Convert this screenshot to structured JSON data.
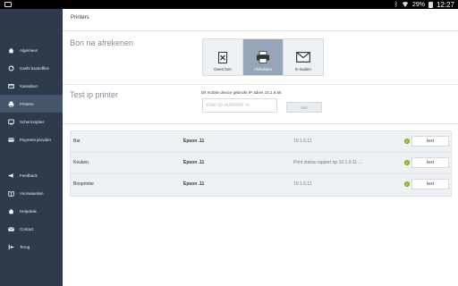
{
  "statusbar": {
    "battery": "29%",
    "time": "12:27"
  },
  "sidebar": {
    "items": [
      {
        "label": "Algemeen",
        "icon": "home-icon"
      },
      {
        "label": "Cashi backoffice",
        "icon": "refresh-icon"
      },
      {
        "label": "Kassabon",
        "icon": "receipt-icon"
      },
      {
        "label": "Printers",
        "icon": "printer-icon",
        "active": true
      },
      {
        "label": "Schermopties",
        "icon": "screen-icon"
      },
      {
        "label": "Payment provider",
        "icon": "card-icon"
      },
      {
        "label": "Feedback",
        "icon": "megaphone-icon"
      },
      {
        "label": "Voorwaarden",
        "icon": "book-icon"
      },
      {
        "label": "Helpdesk",
        "icon": "help-home-icon"
      },
      {
        "label": "Contact",
        "icon": "mail-icon"
      },
      {
        "label": "Terug",
        "icon": "back-icon"
      }
    ]
  },
  "page": {
    "title": "Printers"
  },
  "receipt_section": {
    "label": "Bon na afrekenen",
    "options": [
      {
        "label": "Geen bon",
        "icon": "no-receipt-icon"
      },
      {
        "label": "Afdrukken",
        "icon": "printer-icon",
        "active": true
      },
      {
        "label": "E-mailen",
        "icon": "envelope-icon"
      }
    ]
  },
  "test_section": {
    "label": "Test ip printer",
    "note": "Dit mobile device gebruikt IP adres 10.1.6.65",
    "input_placeholder": "Voer ip-nummer in",
    "button_label": "test"
  },
  "printers": [
    {
      "name": "Bar",
      "model": "Epson .11",
      "address": "10.1.6.11",
      "test_label": "test"
    },
    {
      "name": "Keuken",
      "model": "Epson .11",
      "address": "Print status rapport op 10.1.6.11 ...",
      "test_label": "test"
    },
    {
      "name": "Bonprinter",
      "model": "Epson .11",
      "address": "10.1.6.11",
      "test_label": "test"
    }
  ],
  "colors": {
    "sidebar_bg": "#2d3b4a",
    "sidebar_active": "#46566a",
    "option_active": "#95a6ba",
    "status_ok": "#a5c63b"
  }
}
